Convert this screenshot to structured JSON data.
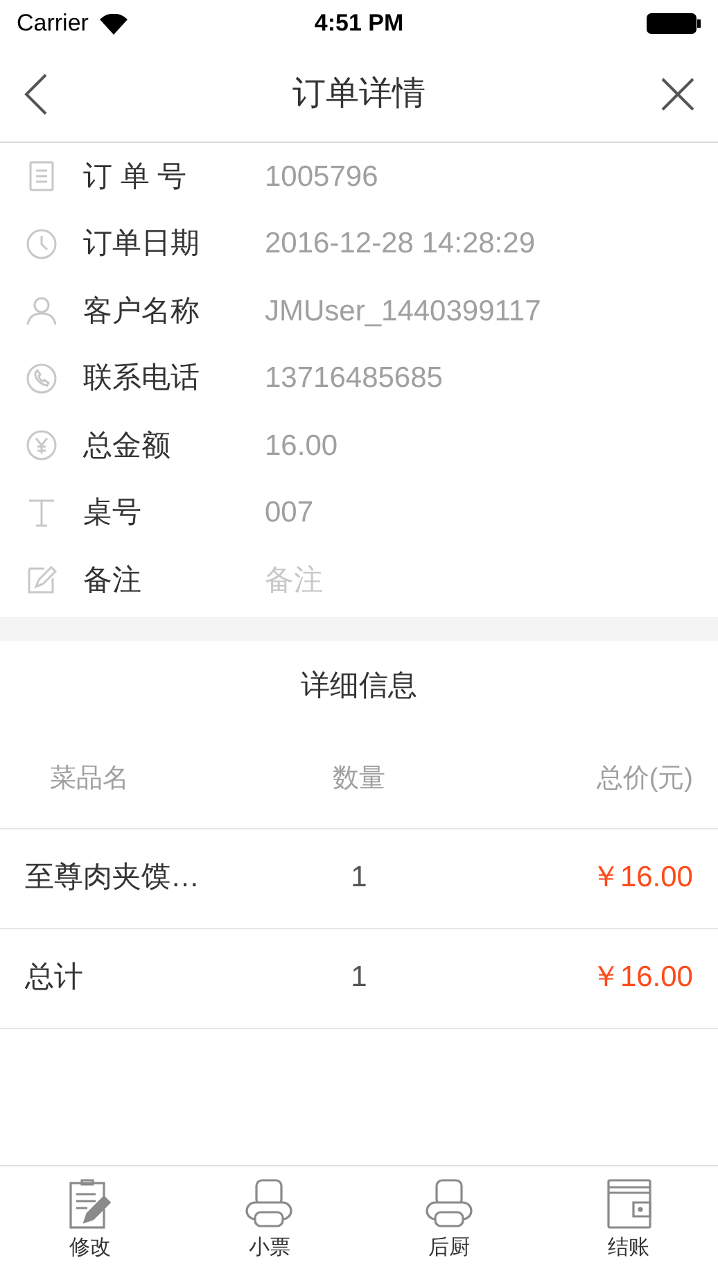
{
  "status_bar": {
    "carrier": "Carrier",
    "time": "4:51 PM"
  },
  "nav": {
    "title": "订单详情"
  },
  "fields": [
    {
      "kind": "order",
      "label": "订 单 号",
      "value": "1005796"
    },
    {
      "kind": "clock",
      "label": "订单日期",
      "value": "2016-12-28 14:28:29"
    },
    {
      "kind": "user",
      "label": "客户名称",
      "value": "JMUser_1440399117"
    },
    {
      "kind": "phone",
      "label": "联系电话",
      "value": "13716485685"
    },
    {
      "kind": "yen",
      "label": "总金额",
      "value": "16.00"
    },
    {
      "kind": "table",
      "label": "桌号",
      "value": "007"
    },
    {
      "kind": "note",
      "label": "备注",
      "placeholder": "备注"
    }
  ],
  "details": {
    "title": "详细信息",
    "columns": [
      "菜品名",
      "数量",
      "总价(元)"
    ],
    "rows": [
      {
        "name": "至尊肉夹馍…",
        "qty": "1",
        "price": "￥16.00"
      },
      {
        "name": "总计",
        "qty": "1",
        "price": "￥16.00"
      }
    ]
  },
  "toolbar": [
    {
      "kind": "edit",
      "label": "修改"
    },
    {
      "kind": "printer",
      "label": "小票"
    },
    {
      "kind": "printer",
      "label": "后厨"
    },
    {
      "kind": "wallet",
      "label": "结账"
    }
  ]
}
